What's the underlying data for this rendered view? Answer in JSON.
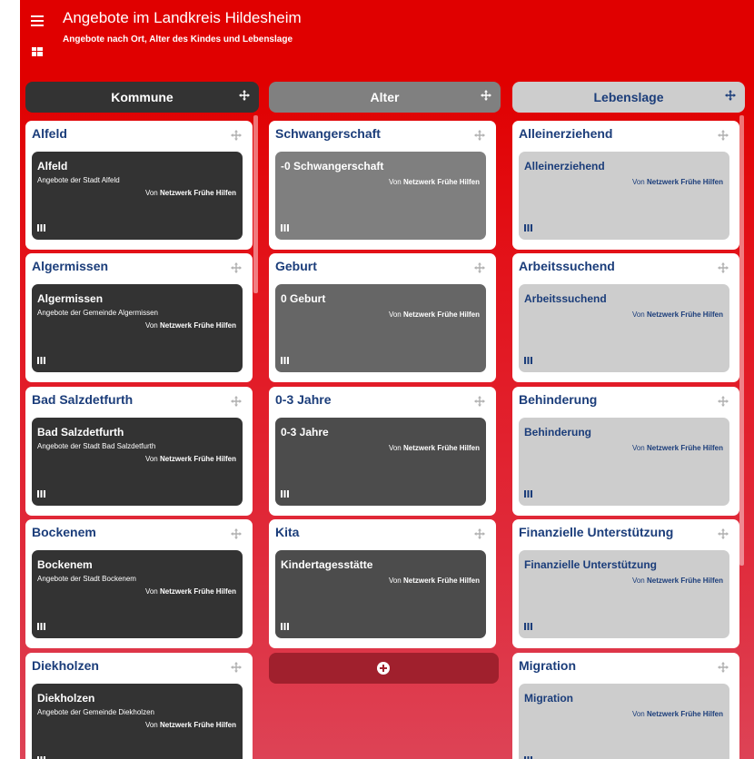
{
  "header": {
    "title": "Angebote im Landkreis Hildesheim",
    "subtitle": "Angebote nach Ort, Alter des Kindes und Lebenslage"
  },
  "columns": [
    {
      "label": "Kommune",
      "bg": "#333333",
      "fg": "#ffffff"
    },
    {
      "label": "Alter",
      "bg": "#808080",
      "fg": "#ffffff"
    },
    {
      "label": "Lebenslage",
      "bg": "#cdcdcd",
      "fg": "#1b3d7a"
    }
  ],
  "kommune": [
    {
      "title": "Alfeld",
      "tile_title": "Alfeld",
      "desc": "Angebote der Stadt Alfeld",
      "by_prefix": "Von",
      "by_org": "Netzwerk Frühe Hilfen"
    },
    {
      "title": "Algermissen",
      "tile_title": "Algermissen",
      "desc": "Angebote der Gemeinde Algermissen",
      "by_prefix": "Von",
      "by_org": "Netzwerk Frühe Hilfen"
    },
    {
      "title": "Bad Salzdetfurth",
      "tile_title": "Bad Salzdetfurth",
      "desc": "Angebote der Stadt Bad Salzdetfurth",
      "by_prefix": "Von",
      "by_org": "Netzwerk Frühe Hilfen"
    },
    {
      "title": "Bockenem",
      "tile_title": "Bockenem",
      "desc": "Angebote der Stadt Bockenem",
      "by_prefix": "Von",
      "by_org": "Netzwerk Frühe Hilfen"
    },
    {
      "title": "Diekholzen",
      "tile_title": "Diekholzen",
      "desc": "Angebote der Gemeinde Diekholzen",
      "by_prefix": "Von",
      "by_org": "Netzwerk Frühe Hilfen"
    }
  ],
  "alter": [
    {
      "title": "Schwangerschaft",
      "tile_title": "-0 Schwangerschaft",
      "by_prefix": "Von",
      "by_org": "Netzwerk Frühe Hilfen",
      "tile_color": "#7f7f7f"
    },
    {
      "title": "Geburt",
      "tile_title": "0 Geburt",
      "by_prefix": "Von",
      "by_org": "Netzwerk Frühe Hilfen",
      "tile_color": "#666666"
    },
    {
      "title": "0-3 Jahre",
      "tile_title": "0-3 Jahre",
      "by_prefix": "Von",
      "by_org": "Netzwerk Frühe Hilfen",
      "tile_color": "#4c4c4c"
    },
    {
      "title": "Kita",
      "tile_title": "Kindertagesstätte",
      "by_prefix": "Von",
      "by_org": "Netzwerk Frühe Hilfen",
      "tile_color": "#4c4c4c"
    }
  ],
  "lebenslage": [
    {
      "title": "Alleinerziehend",
      "tile_title": "Alleinerziehend",
      "by_prefix": "Von",
      "by_org": "Netzwerk Frühe Hilfen"
    },
    {
      "title": "Arbeitssuchend",
      "tile_title": "Arbeitssuchend",
      "by_prefix": "Von",
      "by_org": "Netzwerk Frühe Hilfen"
    },
    {
      "title": "Behinderung",
      "tile_title": "Behinderung",
      "by_prefix": "Von",
      "by_org": "Netzwerk Frühe Hilfen"
    },
    {
      "title": "Finanzielle Unterstützung",
      "tile_title": "Finanzielle Unterstützung",
      "by_prefix": "Von",
      "by_org": "Netzwerk Frühe Hilfen"
    },
    {
      "title": "Migration",
      "tile_title": "Migration",
      "by_prefix": "Von",
      "by_org": "Netzwerk Frühe Hilfen"
    }
  ],
  "icons": {
    "menu": "menu-icon",
    "grid": "grid-view-icon",
    "drag": "move-icon",
    "tile": "bars-icon",
    "add": "plus-circle-icon"
  },
  "colors": {
    "brand_red": "#e00000",
    "title_blue": "#1b3d7a",
    "add_button": "#a0202d"
  }
}
